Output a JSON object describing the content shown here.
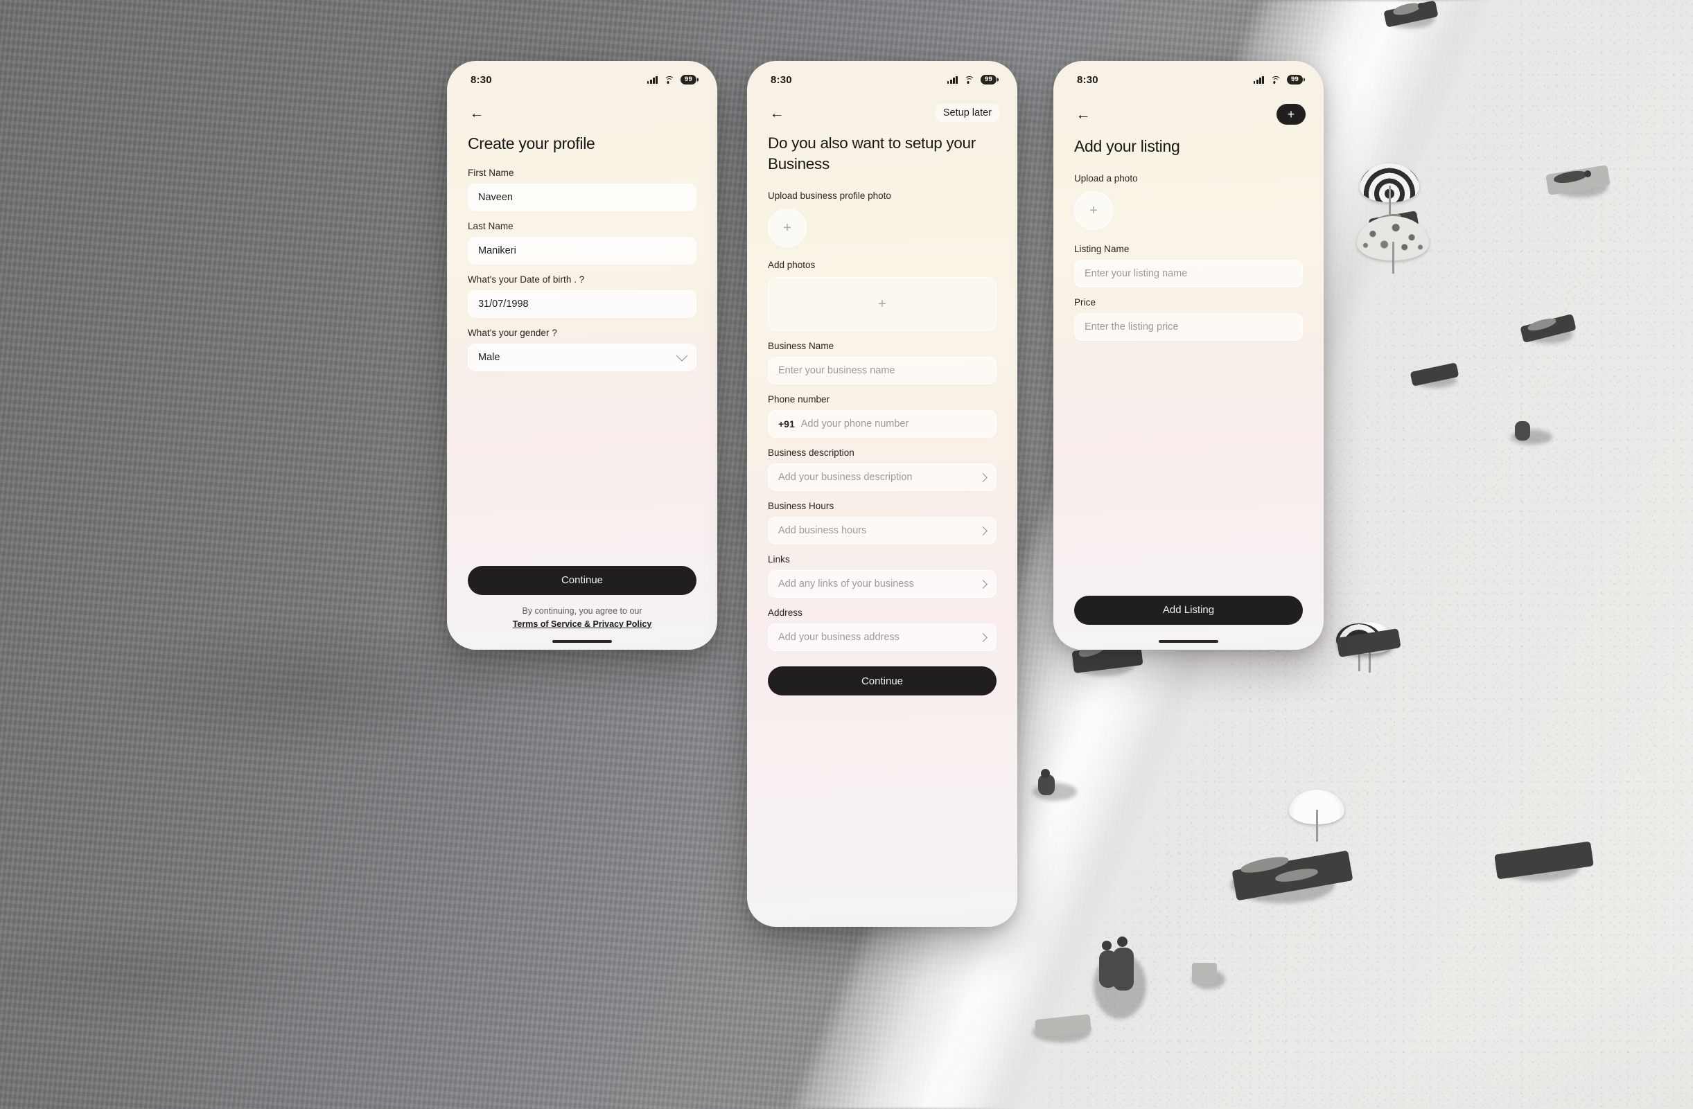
{
  "background": {
    "description": "aerial black-and-white beach photograph with sea, surf line, sand, umbrellas and sunbathers",
    "tone_water": "#7b7d7f",
    "tone_sand": "#ebeae7"
  },
  "status_bar": {
    "time": "8:30",
    "battery": "99",
    "signal_icon": "cellular-signal-icon",
    "wifi_icon": "wifi-icon",
    "battery_icon": "battery-icon"
  },
  "screens": [
    {
      "id": "create-profile",
      "nav": {
        "back_icon": "back-arrow-icon",
        "action_label": ""
      },
      "title": "Create your profile",
      "fields": [
        {
          "label": "First Name",
          "value": "Naveen",
          "placeholder": "",
          "type": "text"
        },
        {
          "label": "Last Name",
          "value": "Manikeri",
          "placeholder": "",
          "type": "text"
        },
        {
          "label": "What's your Date of birth . ?",
          "value": "31/07/1998",
          "placeholder": "",
          "type": "text"
        },
        {
          "label": "What's your gender ?",
          "value": "Male",
          "placeholder": "",
          "type": "select",
          "icon": "chevron-down-icon"
        }
      ],
      "cta": "Continue",
      "terms_text": "By continuing, you agree to our",
      "terms_link": "Terms of Service & Privacy Policy"
    },
    {
      "id": "setup-business",
      "nav": {
        "back_icon": "back-arrow-icon",
        "action_label": "Setup later"
      },
      "title": "Do you also want to setup your Business",
      "upload_photo_label": "Upload business profile photo",
      "upload_photo_icon": "plus-icon",
      "add_photos_label": "Add photos",
      "add_photos_icon": "plus-icon",
      "fields": [
        {
          "label": "Business Name",
          "value": "",
          "placeholder": "Enter your business name",
          "type": "text"
        },
        {
          "label": "Phone number",
          "value": "",
          "placeholder": "Add your phone number",
          "prefix": "+91",
          "type": "tel"
        },
        {
          "label": "Business description",
          "value": "",
          "placeholder": "Add your business description",
          "type": "navigate",
          "icon": "chevron-right-icon"
        },
        {
          "label": "Business Hours",
          "value": "",
          "placeholder": "Add business hours",
          "type": "navigate",
          "icon": "chevron-right-icon"
        },
        {
          "label": "Links",
          "value": "",
          "placeholder": "Add any links of your business",
          "type": "navigate",
          "icon": "chevron-right-icon"
        },
        {
          "label": "Address",
          "value": "",
          "placeholder": "Add your business address",
          "type": "navigate",
          "icon": "chevron-right-icon"
        }
      ],
      "cta": "Continue"
    },
    {
      "id": "add-listing",
      "nav": {
        "back_icon": "back-arrow-icon",
        "fab_icon": "plus-icon"
      },
      "title": "Add your listing",
      "upload_photo_label": "Upload a photo",
      "upload_photo_icon": "plus-icon",
      "fields": [
        {
          "label": "Listing Name",
          "value": "",
          "placeholder": "Enter your listing name",
          "type": "text"
        },
        {
          "label": "Price",
          "value": "",
          "placeholder": "Enter the listing price",
          "type": "text"
        }
      ],
      "cta": "Add Listing"
    }
  ],
  "colors": {
    "button_dark": "#201f1d",
    "screen_cream": "#f9f3e6",
    "screen_pink": "#f8efef",
    "text_primary": "#171614",
    "text_placeholder": "#9d9a96"
  }
}
